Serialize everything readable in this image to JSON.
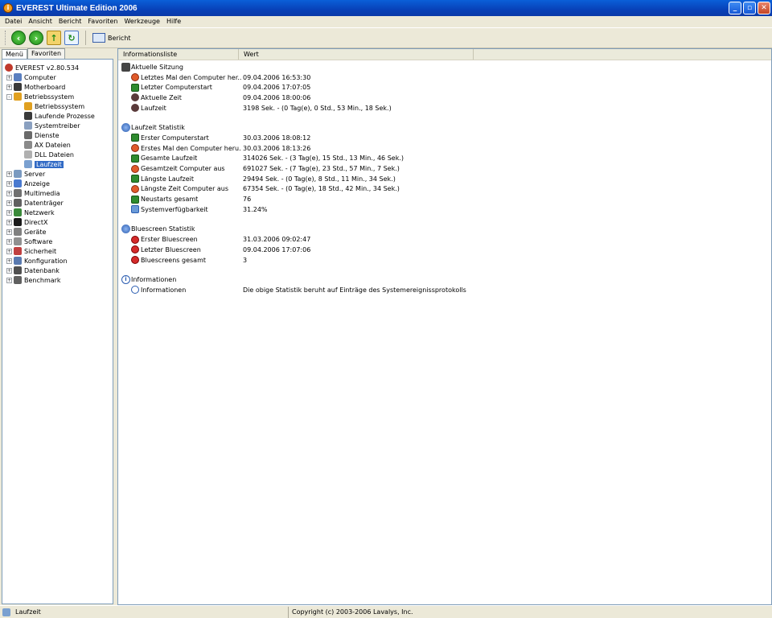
{
  "window": {
    "title": "EVEREST Ultimate Edition 2006"
  },
  "menu": [
    "Datei",
    "Ansicht",
    "Bericht",
    "Favoriten",
    "Werkzeuge",
    "Hilfe"
  ],
  "toolbar": {
    "report_label": "Bericht"
  },
  "left_tabs": [
    "Menü",
    "Favoriten"
  ],
  "tree": {
    "root": "EVEREST v2.80.534",
    "items": [
      {
        "label": "Computer",
        "expander": "+",
        "level": 1,
        "color": "#5a7fc0"
      },
      {
        "label": "Motherboard",
        "expander": "+",
        "level": 1,
        "color": "#3a3a3a"
      },
      {
        "label": "Betriebssystem",
        "expander": "-",
        "level": 1,
        "color": "#e0a020"
      },
      {
        "label": "Betriebssystem",
        "expander": "",
        "level": 2,
        "color": "#e0a020"
      },
      {
        "label": "Laufende Prozesse",
        "expander": "",
        "level": 2,
        "color": "#3a3a3a"
      },
      {
        "label": "Systemtreiber",
        "expander": "",
        "level": 2,
        "color": "#8aa0c0"
      },
      {
        "label": "Dienste",
        "expander": "",
        "level": 2,
        "color": "#6a6a6a"
      },
      {
        "label": "AX Dateien",
        "expander": "",
        "level": 2,
        "color": "#8a8a8a"
      },
      {
        "label": "DLL Dateien",
        "expander": "",
        "level": 2,
        "color": "#b0b0b0"
      },
      {
        "label": "Laufzeit",
        "expander": "",
        "level": 2,
        "color": "#7aa0d0",
        "selected": true
      },
      {
        "label": "Server",
        "expander": "+",
        "level": 1,
        "color": "#7a9ac0"
      },
      {
        "label": "Anzeige",
        "expander": "+",
        "level": 1,
        "color": "#4a7ad0"
      },
      {
        "label": "Multimedia",
        "expander": "+",
        "level": 1,
        "color": "#707070"
      },
      {
        "label": "Datenträger",
        "expander": "+",
        "level": 1,
        "color": "#606060"
      },
      {
        "label": "Netzwerk",
        "expander": "+",
        "level": 1,
        "color": "#3a8a3a"
      },
      {
        "label": "DirectX",
        "expander": "+",
        "level": 1,
        "color": "#1a1a1a"
      },
      {
        "label": "Geräte",
        "expander": "+",
        "level": 1,
        "color": "#808080"
      },
      {
        "label": "Software",
        "expander": "+",
        "level": 1,
        "color": "#909090"
      },
      {
        "label": "Sicherheit",
        "expander": "+",
        "level": 1,
        "color": "#c04040"
      },
      {
        "label": "Konfiguration",
        "expander": "+",
        "level": 1,
        "color": "#5a7ab0"
      },
      {
        "label": "Datenbank",
        "expander": "+",
        "level": 1,
        "color": "#505050"
      },
      {
        "label": "Benchmark",
        "expander": "+",
        "level": 1,
        "color": "#606060"
      }
    ]
  },
  "columns": [
    "Informationsliste",
    "Wert"
  ],
  "sections": [
    {
      "title": "Aktuelle Sitzung",
      "icon": "clock",
      "rows": [
        {
          "label": "Letztes Mal den Computer her...",
          "value": "09.04.2006 16:53:30",
          "icon": "orange"
        },
        {
          "label": "Letzter Computerstart",
          "value": "09.04.2006 17:07:05",
          "icon": "green"
        },
        {
          "label": "Aktuelle Zeit",
          "value": "09.04.2006 18:00:06",
          "icon": "dark"
        },
        {
          "label": "Laufzeit",
          "value": "3198 Sek. - (0 Tag(e), 0 Std., 53 Min., 18 Sek.)",
          "icon": "dark"
        }
      ]
    },
    {
      "title": "Laufzeit Statistik",
      "icon": "globe",
      "rows": [
        {
          "label": "Erster Computerstart",
          "value": "30.03.2006 18:08:12",
          "icon": "green"
        },
        {
          "label": "Erstes Mal den Computer heru...",
          "value": "30.03.2006 18:13:26",
          "icon": "orange"
        },
        {
          "label": "Gesamte Laufzeit",
          "value": "314026 Sek. - (3 Tag(e), 15 Std., 13 Min., 46 Sek.)",
          "icon": "green"
        },
        {
          "label": "Gesamtzeit Computer aus",
          "value": "691027 Sek. - (7 Tag(e), 23 Std., 57 Min., 7 Sek.)",
          "icon": "orange"
        },
        {
          "label": "Längste Laufzeit",
          "value": "29494 Sek. - (0 Tag(e), 8 Std., 11 Min., 34 Sek.)",
          "icon": "green"
        },
        {
          "label": "Längste Zeit Computer aus",
          "value": "67354 Sek. - (0 Tag(e), 18 Std., 42 Min., 34 Sek.)",
          "icon": "orange"
        },
        {
          "label": "Neustarts gesamt",
          "value": "76",
          "icon": "green"
        },
        {
          "label": "Systemverfügbarkeit",
          "value": "31.24%",
          "icon": "blue"
        }
      ]
    },
    {
      "title": "Bluescreen Statistik",
      "icon": "globe",
      "rows": [
        {
          "label": "Erster Bluescreen",
          "value": "31.03.2006 09:02:47",
          "icon": "red"
        },
        {
          "label": "Letzter Bluescreen",
          "value": "09.04.2006 17:07:06",
          "icon": "red"
        },
        {
          "label": "Bluescreens gesamt",
          "value": "3",
          "icon": "red"
        }
      ]
    },
    {
      "title": "Informationen",
      "icon": "info",
      "rows": [
        {
          "label": "Informationen",
          "value": "Die obige Statistik beruht auf Einträge des Systemereignissprotokolls",
          "icon": "info"
        }
      ]
    }
  ],
  "status": {
    "left": "Laufzeit",
    "right": "Copyright (c) 2003-2006 Lavalys, Inc."
  }
}
